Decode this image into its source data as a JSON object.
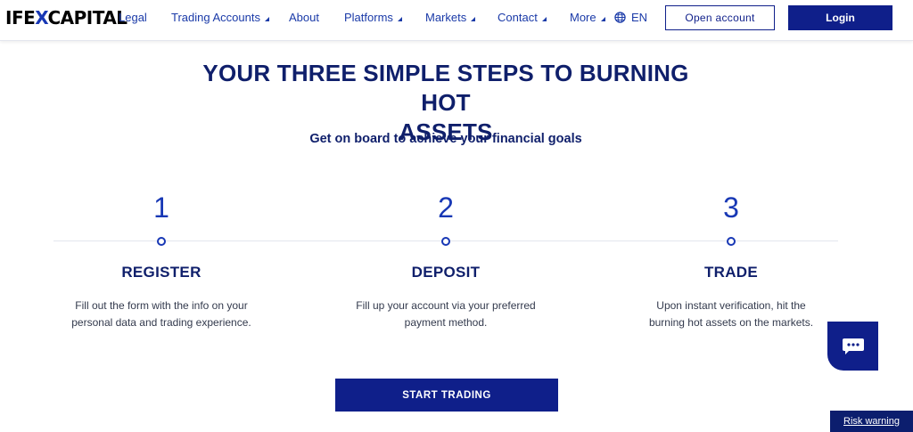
{
  "header": {
    "logo": {
      "part1": "IFE",
      "part2": "X",
      "part3": "CAPITAL"
    },
    "nav": [
      {
        "label": "Legal",
        "has_caret": false
      },
      {
        "label": "Trading Accounts",
        "has_caret": true
      },
      {
        "label": "About",
        "has_caret": false
      },
      {
        "label": "Platforms",
        "has_caret": true
      },
      {
        "label": "Markets",
        "has_caret": true
      },
      {
        "label": "Contact",
        "has_caret": true
      },
      {
        "label": "More",
        "has_caret": true
      }
    ],
    "language": "EN",
    "open_account_label": "Open account",
    "login_label": "Login"
  },
  "main": {
    "title_line1": "YOUR THREE SIMPLE STEPS TO BURNING HOT",
    "title_line2": "ASSETS",
    "subtitle": "Get on board to achieve your financial goals",
    "steps": [
      {
        "number": "1",
        "title": "REGISTER",
        "desc_line1": "Fill out the form with the info on your",
        "desc_line2": "personal data and trading experience."
      },
      {
        "number": "2",
        "title": "DEPOSIT",
        "desc_line1": "Fill up your account via your preferred",
        "desc_line2": "payment method."
      },
      {
        "number": "3",
        "title": "TRADE",
        "desc_line1": "Upon instant verification, hit the",
        "desc_line2": "burning hot assets on the markets."
      }
    ],
    "cta_label": "START TRADING"
  },
  "footer": {
    "risk_warning_label": "Risk warning"
  },
  "colors": {
    "brand_navy": "#0f1f8a",
    "link_blue": "#1a3aa8",
    "accent_blue": "#1838b5"
  },
  "icons": {
    "language": "globe-icon",
    "chat": "chat-icon"
  }
}
